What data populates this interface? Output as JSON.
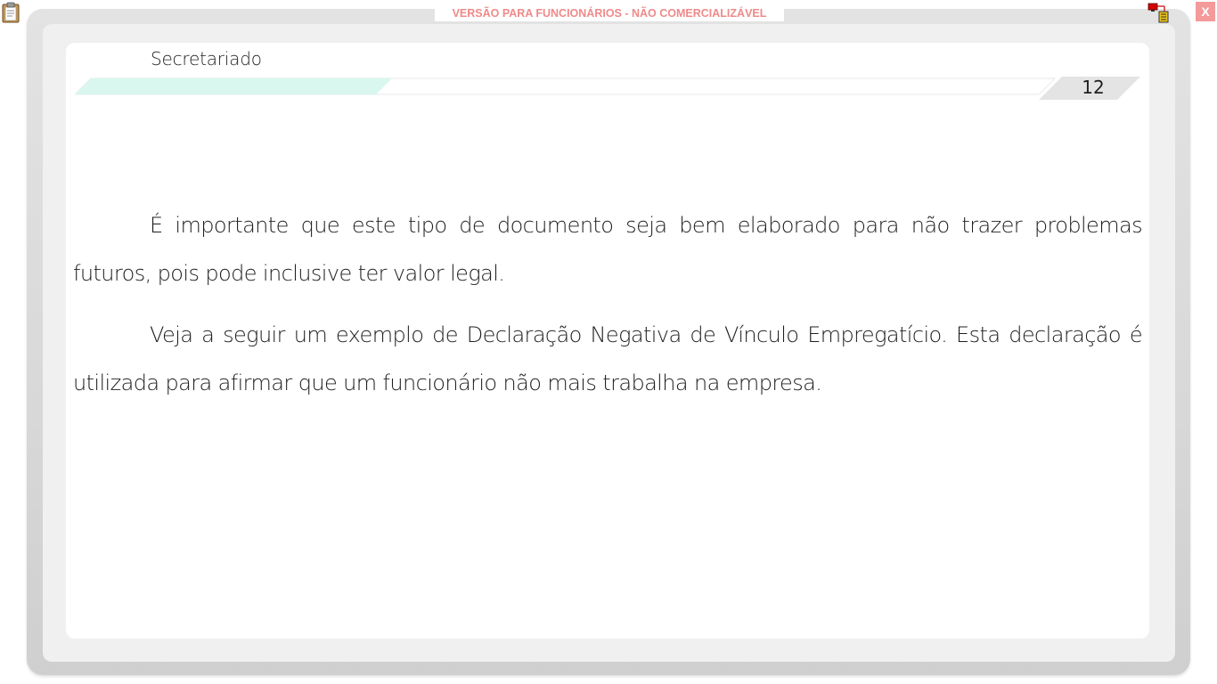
{
  "watermark": {
    "text": "VERSÃO PARA FUNCIONÁRIOS - NÃO COMERCIALIZÁVEL"
  },
  "toolbar": {
    "clipboard_icon": "clipboard-icon",
    "network_icon": "network-monitor-icon",
    "close_label": "X"
  },
  "page": {
    "section_title": "Secretariado",
    "page_number": "12",
    "paragraphs": [
      "É importante que este tipo de documento seja bem elaborado para não trazer problemas futuros, pois pode inclusive ter valor legal.",
      "Veja a seguir um exemplo de Declaração Negativa de Vínculo Empregatício. Esta declaração é utilizada para afirmar que um funcionário não mais trabalha na empresa."
    ]
  },
  "colors": {
    "watermark": "#f08a8a",
    "close_button": "#f49a9a",
    "header_accent": "#d9f7ee",
    "frame": "#dcdcdc"
  }
}
